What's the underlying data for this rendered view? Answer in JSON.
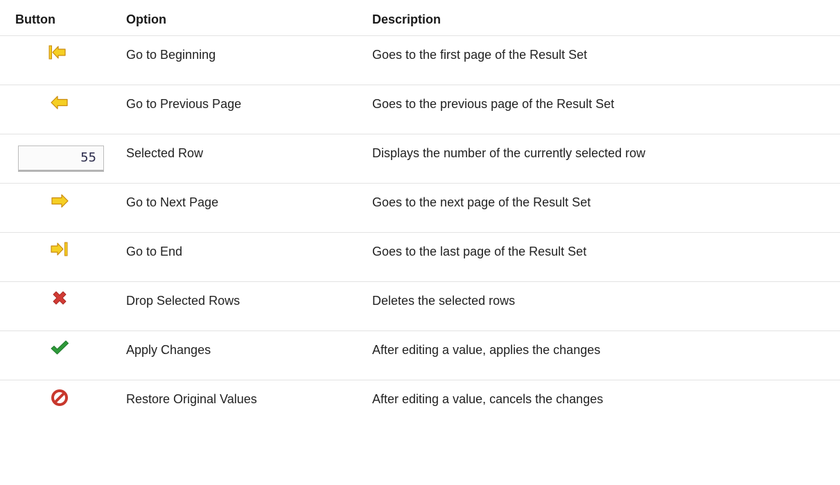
{
  "table": {
    "headers": {
      "button": "Button",
      "option": "Option",
      "description": "Description"
    },
    "rows": [
      {
        "icon": "go-to-beginning-icon",
        "option": "Go to Beginning",
        "description": "Goes to the first page of the Result Set"
      },
      {
        "icon": "go-to-previous-icon",
        "option": "Go to Previous Page",
        "description": "Goes to the previous page of the Result Set"
      },
      {
        "icon": "selected-row-field",
        "value": "55",
        "option": "Selected Row",
        "description": "Displays the number of the currently selected row"
      },
      {
        "icon": "go-to-next-icon",
        "option": "Go to Next Page",
        "description": "Goes to the next page of the Result Set"
      },
      {
        "icon": "go-to-end-icon",
        "option": "Go to End",
        "description": "Goes to the last page of the Result Set"
      },
      {
        "icon": "drop-rows-icon",
        "option": "Drop Selected Rows",
        "description": "Deletes the selected rows"
      },
      {
        "icon": "apply-changes-icon",
        "option": "Apply Changes",
        "description": "After editing a value, applies the changes"
      },
      {
        "icon": "restore-values-icon",
        "option": "Restore Original Values",
        "description": "After editing a value, cancels the changes"
      }
    ]
  },
  "colors": {
    "arrow_fill": "#f5cf24",
    "arrow_stroke": "#c98a0e",
    "drop_red": "#d23b35",
    "check_green": "#2e9a3a",
    "restore_red": "#c8382d"
  }
}
